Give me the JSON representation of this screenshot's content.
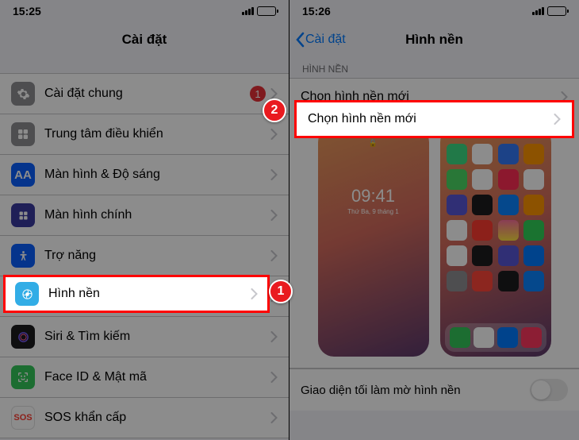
{
  "left": {
    "time": "15:25",
    "title": "Cài đặt",
    "items": [
      {
        "label": "Cài đặt chung",
        "icon": "gear",
        "badge": "1"
      },
      {
        "label": "Trung tâm điều khiển",
        "icon": "ctrl"
      },
      {
        "label": "Màn hình & Độ sáng",
        "icon": "disp",
        "iconText": "AA"
      },
      {
        "label": "Màn hình chính",
        "icon": "home"
      },
      {
        "label": "Trợ năng",
        "icon": "acc"
      },
      {
        "label": "Hình nền",
        "icon": "wall"
      },
      {
        "label": "Siri & Tìm kiếm",
        "icon": "siri"
      },
      {
        "label": "Face ID & Mật mã",
        "icon": "face"
      },
      {
        "label": "SOS khẩn cấp",
        "icon": "sos",
        "iconText": "SOS"
      }
    ]
  },
  "right": {
    "time": "15:26",
    "back": "Cài đặt",
    "title": "Hình nền",
    "section_header": "HÌNH NỀN",
    "choose_wallpaper": "Chọn hình nền mới",
    "lock_time": "09:41",
    "lock_date": "Thứ Ba, 9 tháng 1",
    "dark_appearance_label": "Giao diện tối làm mờ hình nền"
  },
  "annotations": {
    "one": "1",
    "two": "2"
  }
}
